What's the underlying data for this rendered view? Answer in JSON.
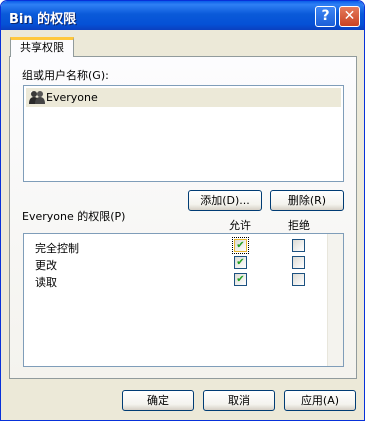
{
  "window": {
    "title": "Bin 的权限",
    "help_symbol": "?",
    "close_symbol": "✕"
  },
  "tab": {
    "label": "共享权限"
  },
  "users": {
    "label": "组或用户名称(G):",
    "items": [
      {
        "name": "Everyone",
        "selected": true
      }
    ],
    "add_button": "添加(D)...",
    "remove_button": "删除(R)"
  },
  "permissions": {
    "label": "Everyone 的权限(P)",
    "allow_header": "允许",
    "deny_header": "拒绝",
    "rows": [
      {
        "name": "完全控制",
        "allow": true,
        "deny": false
      },
      {
        "name": "更改",
        "allow": true,
        "deny": false
      },
      {
        "name": "读取",
        "allow": true,
        "deny": false
      }
    ]
  },
  "footer": {
    "ok": "确定",
    "cancel": "取消",
    "apply": "应用(A)"
  },
  "colors": {
    "titlebar": "#0a5ad9",
    "window_bg": "#ece9d8",
    "check_green": "#21a121",
    "tab_accent": "#ffc83c"
  }
}
